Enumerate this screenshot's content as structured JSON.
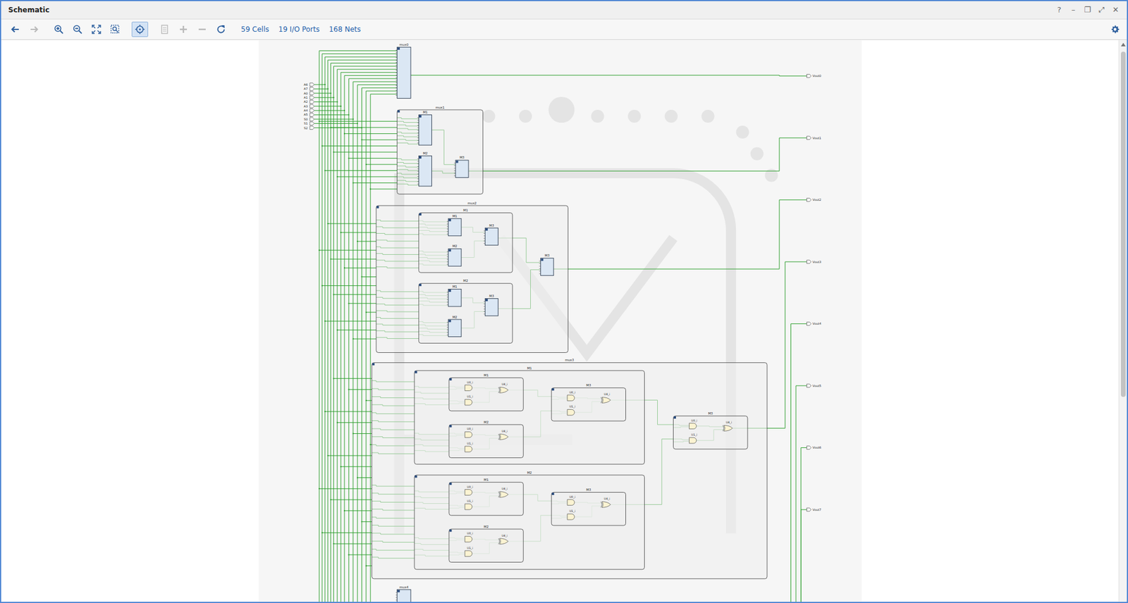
{
  "window": {
    "title": "Schematic",
    "controls": [
      "?",
      "–",
      "❐",
      "⤢",
      "✕"
    ]
  },
  "toolbar": {
    "tools": [
      {
        "kind": "back",
        "disabled": false,
        "selected": false
      },
      {
        "kind": "forward",
        "disabled": true,
        "selected": false
      },
      {
        "kind": "zoom-in",
        "disabled": false,
        "selected": false
      },
      {
        "kind": "zoom-out",
        "disabled": false,
        "selected": false
      },
      {
        "kind": "fit",
        "disabled": false,
        "selected": false
      },
      {
        "kind": "zoom-area",
        "disabled": false,
        "selected": false
      },
      {
        "kind": "select",
        "disabled": false,
        "selected": true
      },
      {
        "kind": "expand",
        "disabled": true,
        "selected": false
      },
      {
        "kind": "add",
        "disabled": true,
        "selected": false
      },
      {
        "kind": "remove",
        "disabled": true,
        "selected": false
      },
      {
        "kind": "refresh",
        "disabled": false,
        "selected": false
      }
    ],
    "stats": [
      "59 Cells",
      "19 I/O Ports",
      "168 Nets"
    ]
  },
  "schematic": {
    "inputs": [
      "A6",
      "A7",
      "A0",
      "A1",
      "A2",
      "A3",
      "A4",
      "A5",
      "S0",
      "S1",
      "S2"
    ],
    "outputs": [
      "Vout0",
      "Vout1",
      "Vout2",
      "Vout3",
      "Vout4",
      "Vout5",
      "Vout6",
      "Vout7"
    ],
    "cells": [
      {
        "label": "mux0",
        "kind": "leaf"
      },
      {
        "label": "mux1",
        "kind": "hier2",
        "children": [
          {
            "label": "M1"
          },
          {
            "label": "M2"
          },
          {
            "label": "M3"
          }
        ]
      },
      {
        "label": "mux2",
        "kind": "hier3",
        "children": [
          {
            "label": "M1",
            "children": [
              {
                "label": "M1"
              },
              {
                "label": "M2"
              },
              {
                "label": "M3"
              }
            ]
          },
          {
            "label": "M2",
            "children": [
              {
                "label": "M1"
              },
              {
                "label": "M2"
              },
              {
                "label": "M3"
              }
            ]
          },
          {
            "label": "M3"
          }
        ]
      },
      {
        "label": "mux3",
        "kind": "gates",
        "children": [
          {
            "label": "M1",
            "children": [
              {
                "label": "M1",
                "gates": [
                  "U0_i",
                  "U1_i",
                  "U4_i"
                ]
              },
              {
                "label": "M2",
                "gates": [
                  "U0_i",
                  "U1_i",
                  "U4_i"
                ]
              },
              {
                "label": "M3",
                "gates": [
                  "U0_i",
                  "U1_i",
                  "U4_i"
                ]
              }
            ]
          },
          {
            "label": "M2",
            "children": [
              {
                "label": "M1",
                "gates": [
                  "U0_i",
                  "U1_i",
                  "U4_i"
                ]
              },
              {
                "label": "M2",
                "gates": [
                  "U0_i",
                  "U1_i",
                  "U4_i"
                ]
              },
              {
                "label": "M3",
                "gates": [
                  "U0_i",
                  "U1_i",
                  "U4_i"
                ]
              }
            ]
          },
          {
            "label": "M3",
            "gates": [
              "U0_i",
              "U1_i",
              "U4_i"
            ]
          }
        ]
      },
      {
        "label": "mux4",
        "kind": "leaf"
      }
    ]
  },
  "scrollbar": {
    "level": 0.62
  }
}
